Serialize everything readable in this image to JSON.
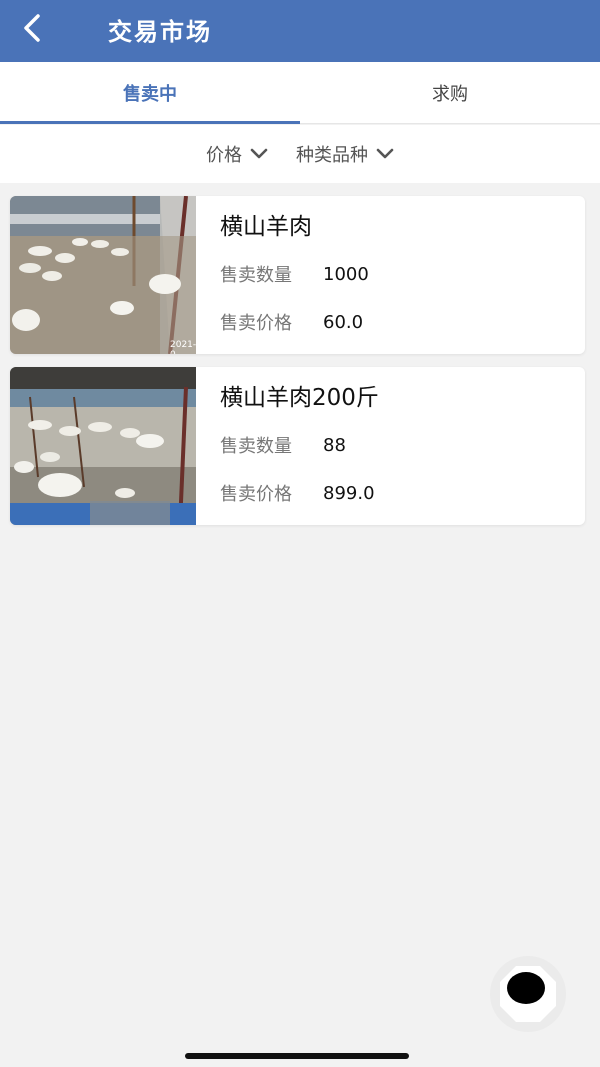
{
  "header": {
    "title": "交易市场",
    "back_icon": "chevron-left-icon"
  },
  "tabs": [
    {
      "label": "售卖中",
      "active": true
    },
    {
      "label": "求购",
      "active": false
    }
  ],
  "filters": [
    {
      "label": "价格",
      "icon": "chevron-down-icon"
    },
    {
      "label": "种类品种",
      "icon": "chevron-down-icon"
    }
  ],
  "listings": [
    {
      "title": "横山羊肉",
      "quantity_label": "售卖数量",
      "quantity": "1000",
      "price_label": "售卖价格",
      "price": "60.0",
      "image_stamp": "2021-0"
    },
    {
      "title": "横山羊肉200斤",
      "quantity_label": "售卖数量",
      "quantity": "88",
      "price_label": "售卖价格",
      "price": "899.0"
    }
  ],
  "colors": {
    "primary": "#4a73b8",
    "background": "#f2f2f2"
  }
}
